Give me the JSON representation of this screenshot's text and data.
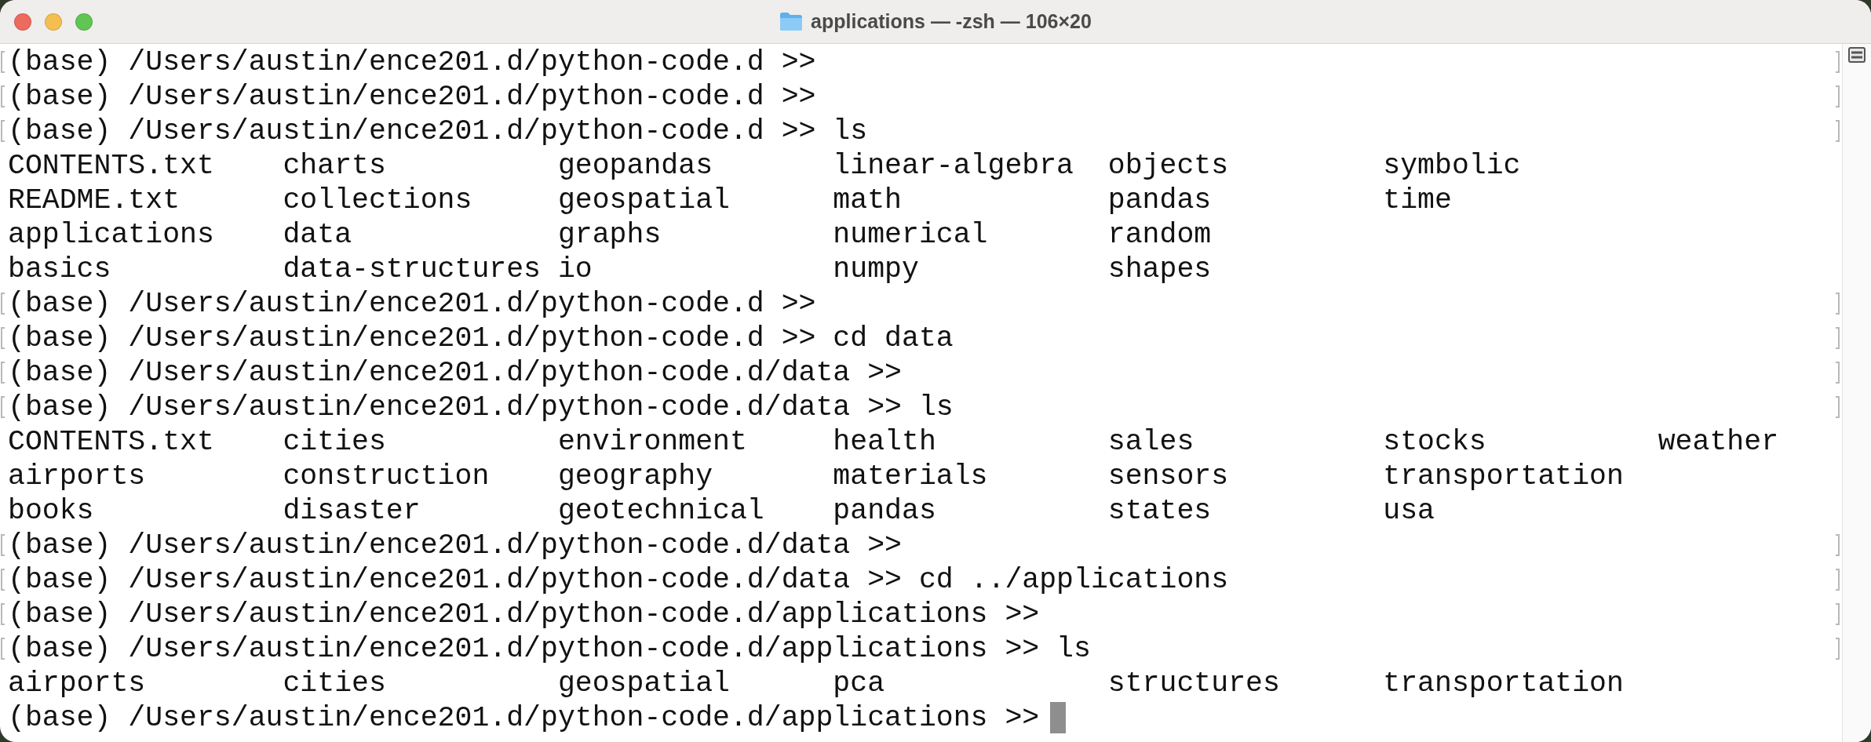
{
  "window": {
    "title": "applications — -zsh — 106×20"
  },
  "lines": [
    {
      "kind": "prompt",
      "text": "(base) /Users/austin/ence201.d/python-code.d >>",
      "marked": true,
      "cursor": false
    },
    {
      "kind": "prompt",
      "text": "(base) /Users/austin/ence201.d/python-code.d >>",
      "marked": true,
      "cursor": false
    },
    {
      "kind": "prompt",
      "text": "(base) /Users/austin/ence201.d/python-code.d >> ls",
      "marked": true,
      "cursor": false
    },
    {
      "kind": "listing",
      "entries": [
        "CONTENTS.txt",
        "charts",
        "geopandas",
        "linear-algebra",
        "objects",
        "symbolic"
      ]
    },
    {
      "kind": "listing",
      "entries": [
        "README.txt",
        "collections",
        "geospatial",
        "math",
        "pandas",
        "time"
      ]
    },
    {
      "kind": "listing",
      "entries": [
        "applications",
        "data",
        "graphs",
        "numerical",
        "random"
      ]
    },
    {
      "kind": "listing",
      "entries": [
        "basics",
        "data-structures",
        "io",
        "numpy",
        "shapes"
      ]
    },
    {
      "kind": "prompt",
      "text": "(base) /Users/austin/ence201.d/python-code.d >>",
      "marked": true,
      "cursor": false
    },
    {
      "kind": "prompt",
      "text": "(base) /Users/austin/ence201.d/python-code.d >> cd data",
      "marked": true,
      "cursor": false
    },
    {
      "kind": "prompt",
      "text": "(base) /Users/austin/ence201.d/python-code.d/data >>",
      "marked": true,
      "cursor": false
    },
    {
      "kind": "prompt",
      "text": "(base) /Users/austin/ence201.d/python-code.d/data >> ls",
      "marked": true,
      "cursor": false
    },
    {
      "kind": "listing",
      "entries": [
        "CONTENTS.txt",
        "cities",
        "environment",
        "health",
        "sales",
        "stocks",
        "weather"
      ]
    },
    {
      "kind": "listing",
      "entries": [
        "airports",
        "construction",
        "geography",
        "materials",
        "sensors",
        "transportation"
      ]
    },
    {
      "kind": "listing",
      "entries": [
        "books",
        "disaster",
        "geotechnical",
        "pandas",
        "states",
        "usa"
      ]
    },
    {
      "kind": "prompt",
      "text": "(base) /Users/austin/ence201.d/python-code.d/data >>",
      "marked": true,
      "cursor": false
    },
    {
      "kind": "prompt",
      "text": "(base) /Users/austin/ence201.d/python-code.d/data >> cd ../applications",
      "marked": true,
      "cursor": false
    },
    {
      "kind": "prompt",
      "text": "(base) /Users/austin/ence201.d/python-code.d/applications >>",
      "marked": true,
      "cursor": false
    },
    {
      "kind": "prompt",
      "text": "(base) /Users/austin/ence201.d/python-code.d/applications >> ls",
      "marked": true,
      "cursor": false
    },
    {
      "kind": "listing",
      "entries": [
        "airports",
        "cities",
        "geospatial",
        "pca",
        "structures",
        "transportation"
      ]
    },
    {
      "kind": "prompt",
      "text": "(base) /Users/austin/ence201.d/python-code.d/applications >>",
      "marked": false,
      "cursor": true
    }
  ]
}
